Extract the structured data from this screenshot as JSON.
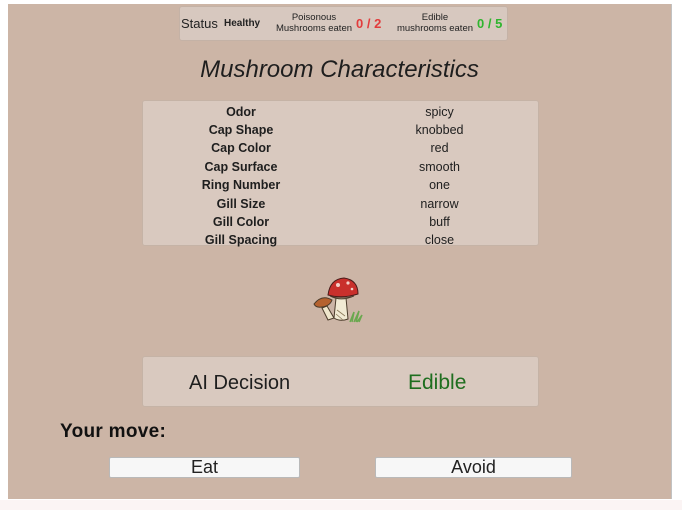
{
  "status_bar": {
    "status_label": "Status",
    "status_value": "Healthy",
    "poisonous_label_line1": "Poisonous",
    "poisonous_label_line2": "Mushrooms eaten",
    "poisonous_count": "0 / 2",
    "edible_label_line1": "Edible",
    "edible_label_line2": "mushrooms eaten",
    "edible_count": "0 / 5"
  },
  "title": "Mushroom Characteristics",
  "characteristics": [
    {
      "name": "Odor",
      "value": "spicy"
    },
    {
      "name": "Cap Shape",
      "value": "knobbed"
    },
    {
      "name": "Cap Color",
      "value": "red"
    },
    {
      "name": "Cap Surface",
      "value": "smooth"
    },
    {
      "name": "Ring Number",
      "value": "one"
    },
    {
      "name": "Gill Size",
      "value": "narrow"
    },
    {
      "name": "Gill Color",
      "value": "buff"
    },
    {
      "name": "Gill Spacing",
      "value": "close"
    }
  ],
  "ai_decision": {
    "label": "AI Decision",
    "value": "Edible"
  },
  "your_move_label": "Your move:",
  "buttons": {
    "eat": "Eat",
    "avoid": "Avoid"
  },
  "icons": {
    "mushroom": "mushroom-icon"
  },
  "colors": {
    "background": "#ccb5a6",
    "poisonous_count": "#e23c3c",
    "edible_count": "#2fb52f",
    "decision_value": "#1f6e1f"
  }
}
